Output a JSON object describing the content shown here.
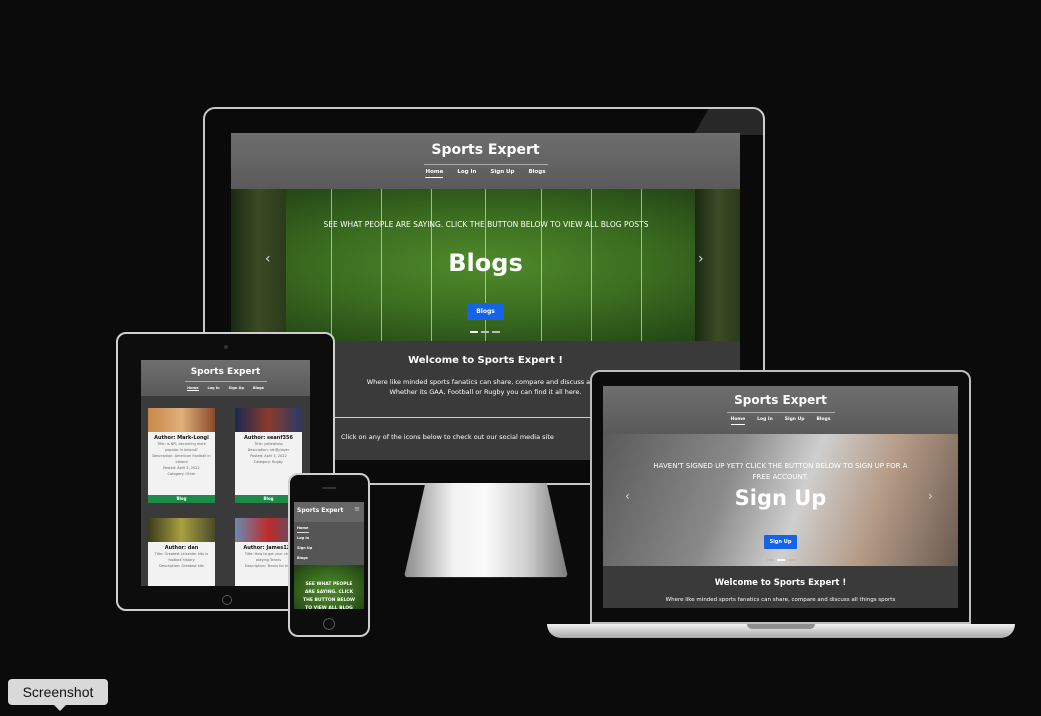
{
  "site": {
    "title": "Sports Expert",
    "nav": [
      "Home",
      "Log In",
      "Sign Up",
      "Blogs"
    ],
    "hero_blogs": {
      "caption": "SEE WHAT PEOPLE ARE SAYING. CLICK THE BUTTON BELOW TO VIEW ALL BLOG POSTS",
      "heading": "Blogs",
      "button": "Blogs"
    },
    "hero_signup": {
      "caption": "HAVEN'T SIGNED UP YET? CLICK THE BUTTON BELOW TO SIGN UP FOR A FREE ACCOUNT.",
      "heading": "Sign Up",
      "button": "Sign Up"
    },
    "welcome_heading": "Welcome to Sports Expert !",
    "welcome_text_1": "Where like minded sports fanatics can share, compare and discuss all thi",
    "welcome_text_2": "Whether its GAA, Football or Rugby you can find it all here.",
    "social_text": "Click on any of the icons below to check out our social media site",
    "laptop_welcome_text": "Where like minded sports fanatics can share, compare and discuss all things sports",
    "carousel_prev": "‹",
    "carousel_next": "›"
  },
  "tablet_cards": [
    {
      "author": "Author: Mark-Longi",
      "lines": [
        "Title: is NFL becoming more",
        "popular in Ireland?",
        "Description: American Football in",
        "Ireland",
        "Posted: April 5, 2022",
        "Category: Other"
      ],
      "button": "Blog",
      "img_color": "#b87a3a"
    },
    {
      "author": "Author: seanf356",
      "lines": [
        "Title: yellowhelp",
        "Description: rdr@player",
        "Posted: April 5, 2022",
        "Category: Rugby"
      ],
      "button": "Blog",
      "img_color": "#2a3a6a"
    },
    {
      "author": "Author: dan",
      "lines": [
        "Title: Greatest Leicester kits in",
        "football history",
        "Description: Greatest kits"
      ],
      "img_color": "#5a5a2a"
    },
    {
      "author": "Author: James123",
      "lines": [
        "Title: How to get your child",
        "playing Tennis",
        "Description: Tennis for kids"
      ],
      "img_color": "#3a5a7a"
    }
  ],
  "phone": {
    "menu_icon": "≡",
    "nav": [
      "Home",
      "Log In",
      "Sign Up",
      "Blogs"
    ],
    "caption": "SEE WHAT PEOPLE ARE SAYING. CLICK THE BUTTON BELOW TO VIEW ALL BLOG POSTS"
  },
  "tooltip": "Screenshot",
  "colors": {
    "accent": "#1463e8",
    "card_button": "#1d8a4a",
    "background": "#0c0b0c"
  }
}
